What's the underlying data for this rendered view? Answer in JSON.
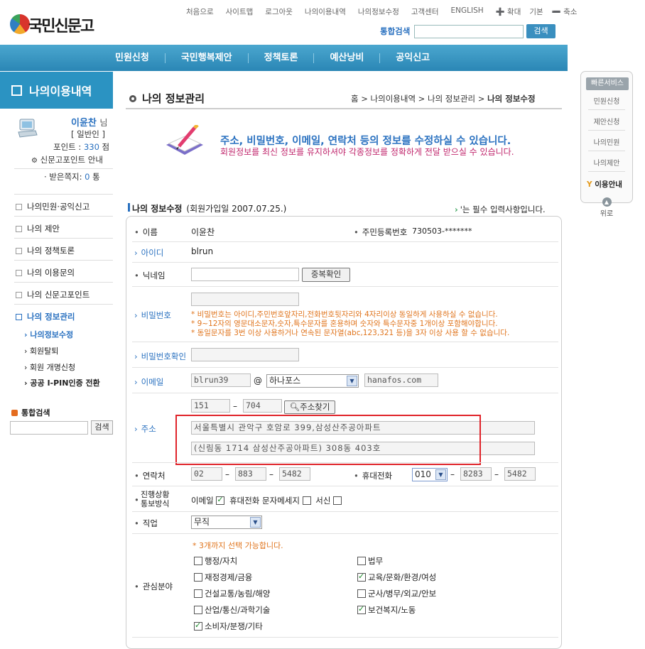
{
  "header": {
    "logo_text": "국민신문고",
    "top_links": [
      "처음으로",
      "사이트맵",
      "로그아웃",
      "나의이용내역",
      "나의정보수정",
      "고객센터",
      "ENGLISH",
      "➕ 확대",
      "기본",
      "➖ 축소"
    ],
    "search_label": "통합검색",
    "search_value": "",
    "search_button": "검색",
    "nav": [
      "민원신청",
      "국민행복제안",
      "정책토론",
      "예산낭비",
      "공익신고"
    ]
  },
  "sidebar": {
    "title": "나의이용내역",
    "user_name": "이윤찬",
    "user_suffix": "님",
    "user_grade": "[ 일반인 ]",
    "point_label": "포인트 :",
    "point_value": "330",
    "point_unit": "점",
    "point_guide": "신문고포인트 안내",
    "msg_label": "· 받은쪽지:",
    "msg_value": "0",
    "msg_unit": "통",
    "menu": [
      "나의민원·공익신고",
      "나의 제안",
      "나의 정책토론",
      "나의 이용문의",
      "나의 신문고포인트",
      "나의 정보관리"
    ],
    "submenu": [
      "나의정보수정",
      "회원탈퇴",
      "회원 개명신청",
      "공공 I-PIN인증 전환"
    ],
    "search_label": "통합검색",
    "search_button": "검색"
  },
  "quick": {
    "title": "빠른서비스",
    "items": [
      "민원신청",
      "제안신청",
      "나의민원",
      "나의제안"
    ],
    "guide": "이용안내",
    "top": "위로"
  },
  "content": {
    "page_title": "나의 정보관리",
    "breadcrumb": [
      "홈",
      "나의이용내역",
      "나의 정보관리",
      "나의 정보수정"
    ],
    "intro_main": "주소, 비밀번호, 이메일, 연락처 등의 정보를 수정하실 수 있습니다.",
    "intro_sub": "회원정보를 최신 정보를 유지하셔야 각종정보를 정확하게 전달 받으실 수 있습니다.",
    "section_title": "나의 정보수정",
    "join_date": "(회원가입일 2007.07.25.)",
    "required_note": "'는 필수 입력사항입니다."
  },
  "form": {
    "name_label": "이름",
    "name_value": "이윤찬",
    "rrn_label": "주민등록번호",
    "rrn_value": "730503-*******",
    "id_label": "아이디",
    "id_value": "blrun",
    "nick_label": "닉네임",
    "nick_value": "",
    "dup_button": "중복확인",
    "pw_label": "비밀번호",
    "pw_notes": [
      "* 비밀번호는 아이디,주민번호앞자리,전화번호뒷자리와 4자리이상 동일하게 사용하실 수 없습니다.",
      "* 9~12자의 영문대소문자,숫자,특수문자를 혼용하며 숫자와 특수문자중 1개이상 포함해야합니다.",
      "* 동일문자를 3번 이상 사용하거나 연속된 문자열(abc,123,321 등)을 3자 이상 사용 할 수 없습니다."
    ],
    "pw_confirm_label": "비밀번호확인",
    "email_label": "이메일",
    "email_id": "blrun39",
    "email_at": "@",
    "email_select": "하나포스",
    "email_domain": "hanafos.com",
    "addr_label": "주소",
    "zip1": "151",
    "zip_dash": "–",
    "zip2": "704",
    "zip_button": "주소찾기",
    "addr1": "서울특별시 관악구 호암로 399,삼성산주공아파트",
    "addr2": "(신림동  1714 삼성산주공아파트) 308동 403호",
    "tel_label": "연락처",
    "tel1": "02",
    "tel2": "883",
    "tel3": "5482",
    "mobile_label": "휴대전화",
    "mobile1": "010",
    "mobile2": "8283",
    "mobile3": "5482",
    "dash": "–",
    "notify_label_1": "진행상황",
    "notify_label_2": "통보방식",
    "notify_email": "이메일",
    "notify_sms": "휴대전화 문자메세지",
    "notify_post": "서신",
    "job_label": "직업",
    "job_value": "무직",
    "interest_label": "관심분야",
    "interest_note": "* 3개까지 선택 가능합니다.",
    "interests": [
      {
        "label": "행정/자치",
        "checked": false
      },
      {
        "label": "법무",
        "checked": false
      },
      {
        "label": "재정경제/금융",
        "checked": false
      },
      {
        "label": "교육/문화/환경/여성",
        "checked": true
      },
      {
        "label": "건설교통/농림/해양",
        "checked": false
      },
      {
        "label": "군사/병무/외교/안보",
        "checked": false
      },
      {
        "label": "산업/통신/과학기술",
        "checked": false
      },
      {
        "label": "보건복지/노동",
        "checked": true
      },
      {
        "label": "소비자/분쟁/기타",
        "checked": true
      }
    ]
  }
}
